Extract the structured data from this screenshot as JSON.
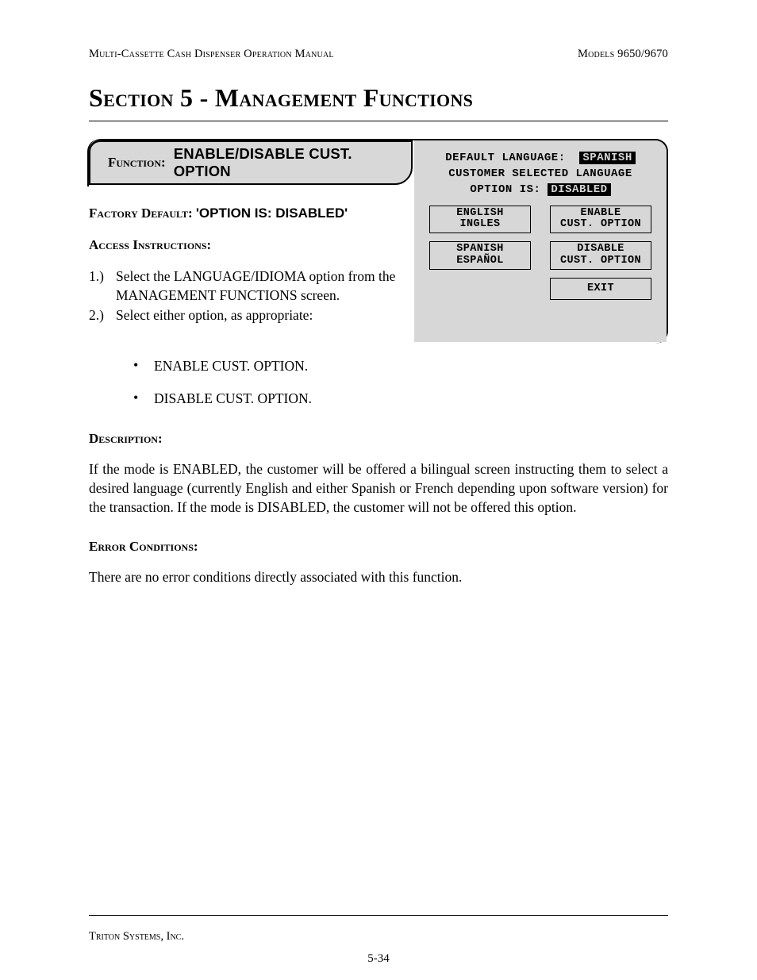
{
  "header": {
    "left": "Multi-Cassette Cash Dispenser Operation Manual",
    "right": "Models 9650/9670"
  },
  "title": "Section 5 - Management Functions",
  "function_box": {
    "label": "Function:",
    "name": "ENABLE/DISABLE CUST. OPTION"
  },
  "screen": {
    "line1_prefix": "DEFAULT LANGUAGE:",
    "line1_value": "SPANISH",
    "line2": "CUSTOMER SELECTED LANGUAGE",
    "line3_prefix": "OPTION IS:",
    "line3_value": "DISABLED",
    "buttons": {
      "english": "ENGLISH\nINGLES",
      "enable": "ENABLE\nCUST. OPTION",
      "spanish": "SPANISH\nESPAÑOL",
      "disable": "DISABLE\nCUST. OPTION",
      "exit": "EXIT"
    }
  },
  "factory_default": {
    "label": "Factory Default:",
    "value": "'OPTION IS: DISABLED'"
  },
  "access": {
    "heading": "Access Instructions:",
    "items": [
      "Select the LANGUAGE/IDIOMA option from the MANAGEMENT FUNCTIONS screen.",
      "Select either option, as appropriate:"
    ],
    "bullets": [
      "ENABLE CUST. OPTION.",
      "DISABLE CUST. OPTION."
    ]
  },
  "description": {
    "heading": "Description:",
    "text": "If the mode is ENABLED, the customer will be offered a bilingual screen instructing them to select a desired language (currently English and either Spanish or French depending upon software version) for the transaction. If the mode is DISABLED, the customer will not be offered this option."
  },
  "errors": {
    "heading": "Error Conditions:",
    "text": "There are no error conditions directly associated with this function."
  },
  "footer": {
    "company": "Triton Systems, Inc.",
    "page": "5-34"
  }
}
